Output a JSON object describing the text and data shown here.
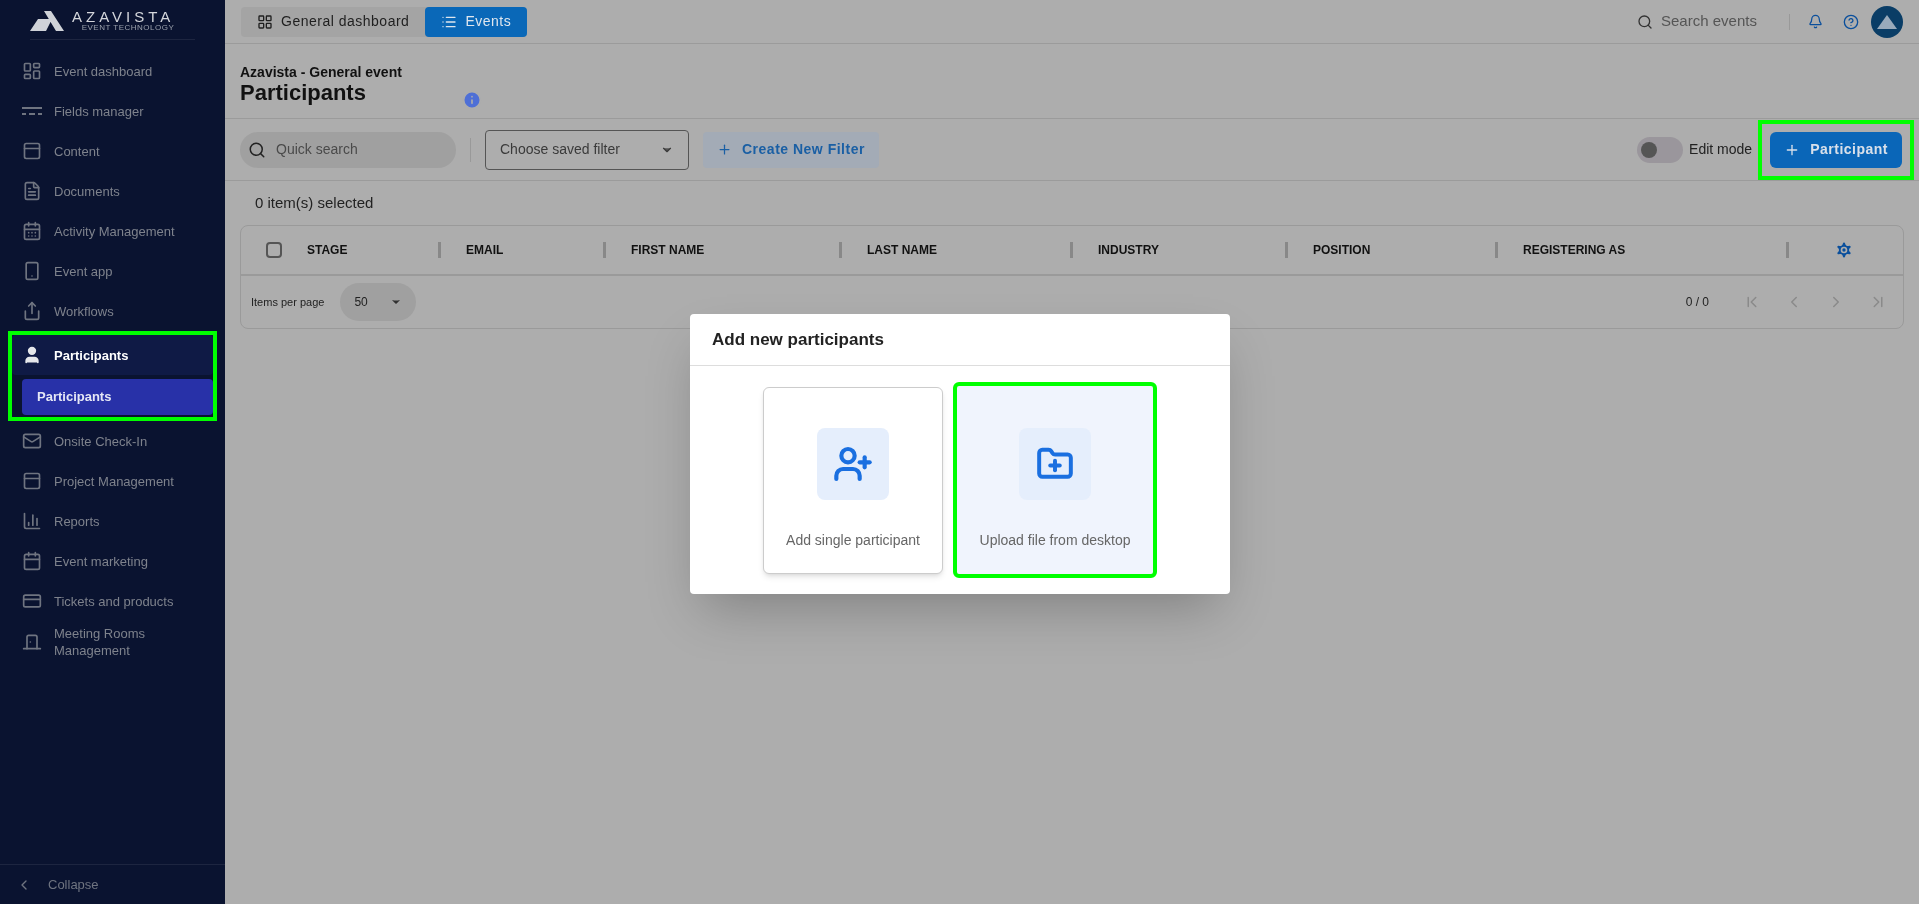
{
  "sidebar": {
    "logo": {
      "name": "AZAVISTA",
      "tagline": "EVENT TECHNOLOGY"
    },
    "items": [
      {
        "label": "Event dashboard",
        "selected": false,
        "highlighted": false
      },
      {
        "label": "Fields manager",
        "selected": false,
        "highlighted": false
      },
      {
        "label": "Content",
        "selected": false,
        "highlighted": false
      },
      {
        "label": "Documents",
        "selected": false,
        "highlighted": false
      },
      {
        "label": "Activity Management",
        "selected": false,
        "highlighted": false
      },
      {
        "label": "Event app",
        "selected": false,
        "highlighted": false
      },
      {
        "label": "Workflows",
        "selected": false,
        "highlighted": false
      },
      {
        "label": "Participants",
        "selected": true,
        "highlighted": true,
        "children": [
          {
            "label": "Participants",
            "selected": true
          }
        ]
      },
      {
        "label": "Onsite Check-In",
        "selected": false,
        "highlighted": false
      },
      {
        "label": "Project Management",
        "selected": false,
        "highlighted": false
      },
      {
        "label": "Reports",
        "selected": false,
        "highlighted": false
      },
      {
        "label": "Event marketing",
        "selected": false,
        "highlighted": false
      },
      {
        "label": "Tickets and products",
        "selected": false,
        "highlighted": false
      },
      {
        "label": "Meeting Rooms Management",
        "selected": false,
        "highlighted": false
      }
    ],
    "collapse": "Collapse"
  },
  "topbar": {
    "tabs": [
      {
        "label": "General dashboard",
        "selected": false
      },
      {
        "label": "Events",
        "selected": true
      }
    ],
    "search": {
      "placeholder": "Search events"
    }
  },
  "page": {
    "breadcrumb": "Azavista - General event",
    "title": "Participants"
  },
  "toolbar": {
    "quick_search": {
      "placeholder": "Quick search"
    },
    "saved_filter": "Choose saved filter",
    "create_filter": "Create New Filter",
    "edit_mode": {
      "label": "Edit mode",
      "on": false
    },
    "add_button": {
      "label": "Participant",
      "highlighted": true
    }
  },
  "selection": "0 item(s) selected",
  "table": {
    "select_all": {
      "checked": false
    },
    "columns": [
      "STAGE",
      "EMAIL",
      "FIRST NAME",
      "LAST NAME",
      "INDUSTRY",
      "POSITION",
      "REGISTERING AS"
    ],
    "footer": {
      "items_per_page": "Items per page",
      "page_size": "50",
      "range": "0 / 0"
    }
  },
  "modal": {
    "title": "Add new participants",
    "options": [
      {
        "label": "Add single participant",
        "highlighted": false
      },
      {
        "label": "Upload file from desktop",
        "highlighted": true
      }
    ]
  }
}
